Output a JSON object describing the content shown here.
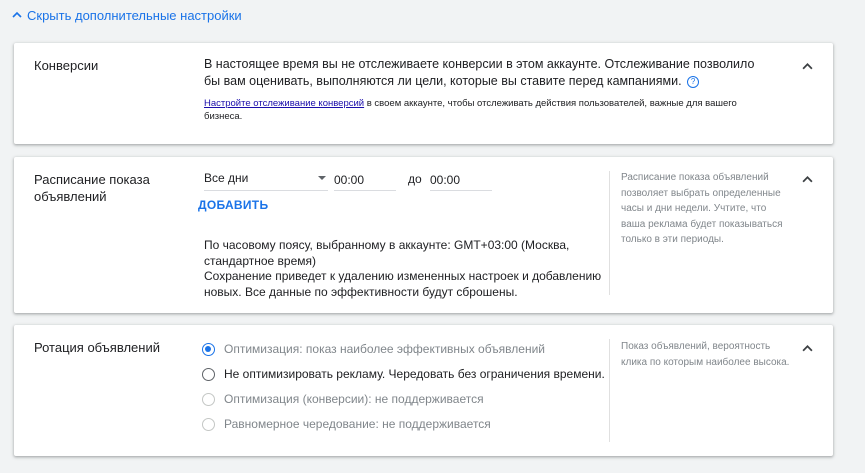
{
  "header": {
    "toggle_label": "Скрыть дополнительные настройки"
  },
  "conversions": {
    "title": "Конверсии",
    "text": "В настоящее время вы не отслеживаете конверсии в этом аккаунте. Отслеживание позволило бы вам оценивать, выполняются ли цели, которые вы ставите перед кампаниями.",
    "help_glyph": "?",
    "link_text": "Настройте отслеживание конверсий",
    "link_tail": " в своем аккаунте, чтобы отслеживать действия пользователей, важные для вашего бизнеса."
  },
  "schedule": {
    "title_line1": "Расписание показа",
    "title_line2": "объявлений",
    "days_value": "Все дни",
    "from_value": "00:00",
    "to_label": "до",
    "to_value": "00:00",
    "add_label": "ДОБАВИТЬ",
    "timezone_text": "По часовому поясу, выбранному в аккаунте: GMT+03:00 (Москва, стандартное время)",
    "warning_text": "Сохранение приведет к удалению измененных настроек и добавлению новых. Все данные по эффективности будут сброшены.",
    "help_text": "Расписание показа объявлений позволяет выбрать определенные часы и дни недели. Учтите, что ваша реклама будет показываться только в эти периоды."
  },
  "rotation": {
    "title": "Ротация объявлений",
    "options": [
      {
        "label": "Оптимизация: показ наиболее эффективных объявлений",
        "state": "selected"
      },
      {
        "label": "Не оптимизировать рекламу. Чередовать без ограничения времени.",
        "state": "enabled"
      },
      {
        "label": "Оптимизация (конверсии): не поддерживается",
        "state": "disabled"
      },
      {
        "label": "Равномерное чередование: не поддерживается",
        "state": "disabled"
      }
    ],
    "help_text": "Показ объявлений, вероятность клика по которым наиболее высока."
  },
  "colors": {
    "accent": "#1a73e8",
    "background": "#f1f3f4",
    "muted_text": "#80868b"
  }
}
